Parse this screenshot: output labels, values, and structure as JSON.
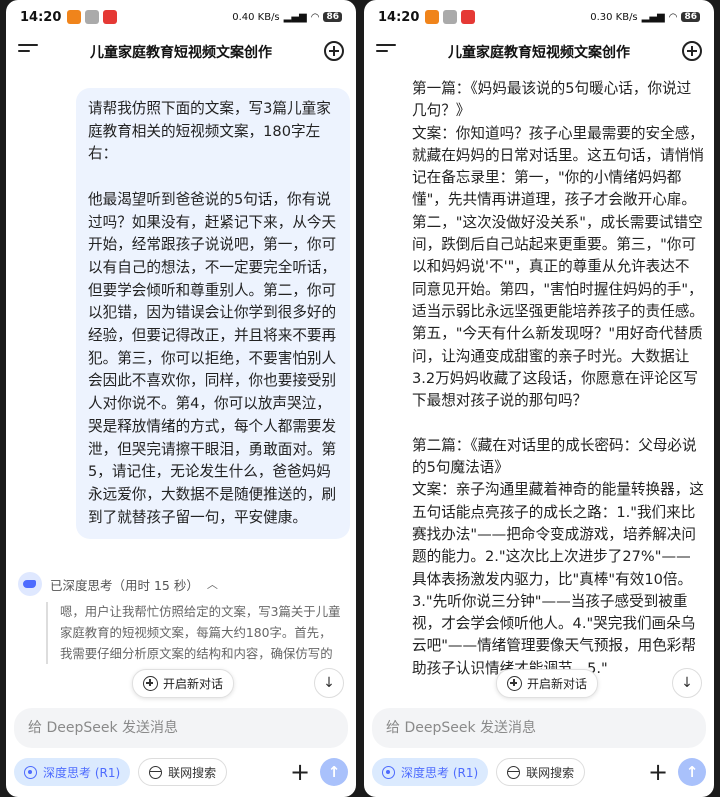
{
  "screens": [
    {
      "status": {
        "time": "14:20",
        "network_speed": "0.40 KB/s",
        "battery": "86"
      },
      "header": {
        "title": "儿童家庭教育短视频文案创作"
      },
      "user_message": "请帮我仿照下面的文案，写3篇儿童家庭教育相关的短视频文案，180字左右：\n\n他最渴望听到爸爸说的5句话，你有说过吗？如果没有，赶紧记下来，从今天开始，经常跟孩子说说吧，第一，你可以有自己的想法，不一定要完全听话，但要学会倾听和尊重别人。第二，你可以犯错，因为错误会让你学到很多好的经验，但要记得改正，并且将来不要再犯。第三，你可以拒绝，不要害怕别人会因此不喜欢你，同样，你也要接受别人对你说不。第4，你可以放声哭泣，哭是释放情绪的方式，每个人都需要发泄，但哭完请擦干眼泪，勇敢面对。第5，请记住，无论发生什么，爸爸妈妈永远爱你，大数据不是随便推送的，刷到了就替孩子留一句，平安健康。",
      "thinking_header": "已深度思考（用时 15 秒）",
      "thinking_text": "嗯，用户让我帮忙仿照给定的文案，写3篇关于儿童家庭教育的短视频文案，每篇大约180字。首先，我需要仔细分析原文案的结构和内容，确保仿写的",
      "new_chat_label": "开启新对话",
      "input_placeholder": "给 DeepSeek 发送消息",
      "deep_think_label": "深度思考 (R1)",
      "web_search_label": "联网搜索"
    },
    {
      "status": {
        "time": "14:20",
        "network_speed": "0.30 KB/s",
        "battery": "86"
      },
      "header": {
        "title": "儿童家庭教育短视频文案创作"
      },
      "assistant_text": "第一篇：《妈妈最该说的5句暖心话，你说过几句？》\n文案：你知道吗？孩子心里最需要的安全感，就藏在妈妈的日常对话里。这五句话，请悄悄记在备忘录里：第一，\"你的小情绪妈妈都懂\"，先共情再讲道理，孩子才会敞开心扉。第二，\"这次没做好没关系\"，成长需要试错空间，跌倒后自己站起来更重要。第三，\"你可以和妈妈说'不'\"，真正的尊重从允许表达不同意见开始。第四，\"害怕时握住妈妈的手\"，适当示弱比永远坚强更能培养孩子的责任感。第五，\"今天有什么新发现呀？\"用好奇代替质问，让沟通变成甜蜜的亲子时光。大数据让3.2万妈妈收藏了这段话，你愿意在评论区写下最想对孩子说的那句吗？\n\n第二篇：《藏在对话里的成长密码：父母必说的5句魔法语》\n文案：亲子沟通里藏着神奇的能量转换器，这五句话能点亮孩子的成长之路：1.\"我们来比赛找办法\"——把命令变成游戏，培养解决问题的能力。2.\"这次比上次进步了27%\"——具体表扬激发内驱力，比\"真棒\"有效10倍。3.\"先听你说三分钟\"——当孩子感受到被重视，才会学会倾听他人。4.\"哭完我们画朵乌云吧\"——情绪管理要像天气预报，用色彩帮助孩子认识情绪才能调节。5.\"",
      "new_chat_label": "开启新对话",
      "input_placeholder": "给 DeepSeek 发送消息",
      "deep_think_label": "深度思考 (R1)",
      "web_search_label": "联网搜索"
    }
  ],
  "colors": {
    "accent": "#4d6bfe",
    "bubble": "#edf3fe",
    "send_disabled": "#a9c1fb"
  }
}
